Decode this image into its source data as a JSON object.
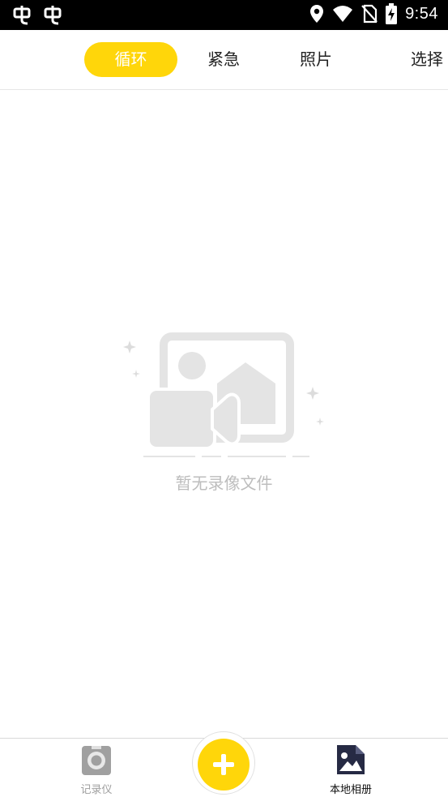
{
  "status_bar": {
    "time": "9:54",
    "icons": [
      "app-notification-icon",
      "app-notification-icon",
      "location-icon",
      "wifi-icon",
      "no-sim-icon",
      "battery-charging-icon"
    ]
  },
  "tabs": [
    {
      "label": "循环",
      "active": true
    },
    {
      "label": "紧急",
      "active": false
    },
    {
      "label": "照片",
      "active": false
    }
  ],
  "select_label": "选择",
  "empty_state": {
    "message": "暂无录像文件",
    "icon": "empty-video-illustration"
  },
  "bottom_nav": {
    "items": [
      {
        "label": "记录仪",
        "icon": "camera-recorder-icon",
        "active": false
      },
      {
        "label": "本地相册",
        "icon": "album-image-icon",
        "active": true
      }
    ],
    "fab_icon": "plus-icon"
  },
  "colors": {
    "accent": "#ffd60a",
    "illustration": "#e4e4e4",
    "muted_text": "#bdbdbd"
  }
}
